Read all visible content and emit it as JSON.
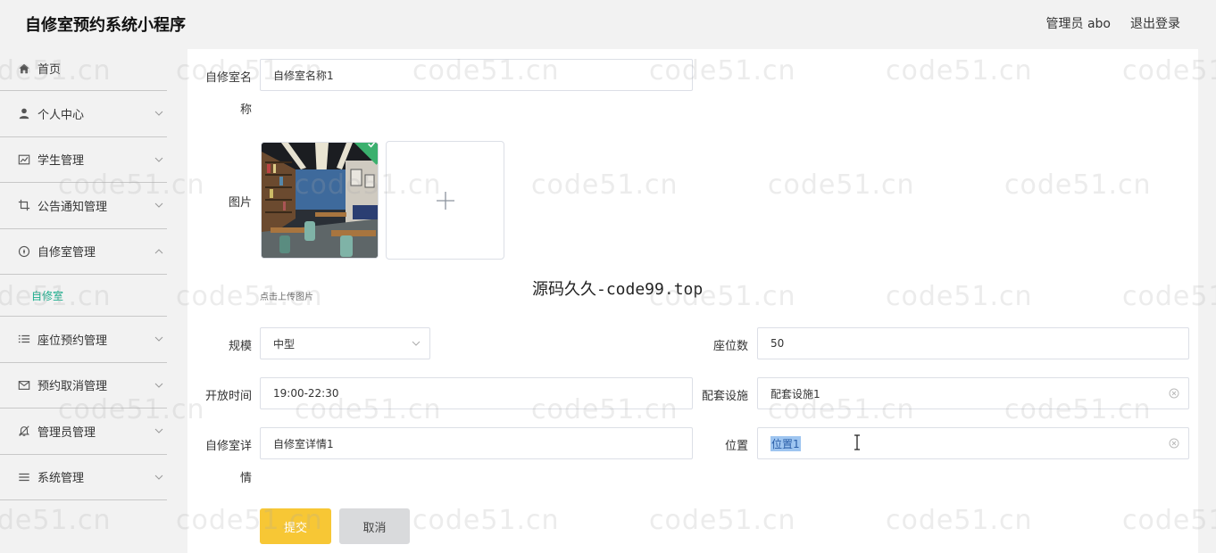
{
  "header": {
    "app_title": "自修室预约系统小程序",
    "user_label": "管理员 abo",
    "logout_label": "退出登录"
  },
  "sidebar": {
    "items": [
      {
        "label": "首页",
        "icon": "home-icon"
      },
      {
        "label": "个人中心",
        "icon": "person-icon"
      },
      {
        "label": "学生管理",
        "icon": "chart-icon"
      },
      {
        "label": "公告通知管理",
        "icon": "crop-icon"
      },
      {
        "label": "自修室管理",
        "icon": "compass-icon",
        "expanded": true,
        "children": [
          {
            "label": "自修室",
            "active": true
          }
        ]
      },
      {
        "label": "座位预约管理",
        "icon": "list-icon"
      },
      {
        "label": "预约取消管理",
        "icon": "mail-icon"
      },
      {
        "label": "管理员管理",
        "icon": "bell-icon"
      },
      {
        "label": "系统管理",
        "icon": "menu-icon"
      }
    ]
  },
  "form": {
    "name_label_1": "自修室名",
    "name_label_2": "称",
    "name_value": "自修室名称1",
    "image_label": "图片",
    "upload_hint": "点击上传图片",
    "scale_label": "规模",
    "scale_value": "中型",
    "seats_label": "座位数",
    "seats_value": "50",
    "open_label": "开放时间",
    "open_value": "19:00-22:30",
    "facility_label": "配套设施",
    "facility_value": "配套设施1",
    "detail_label_1": "自修室详",
    "detail_label_2": "情",
    "detail_value": "自修室详情1",
    "location_label": "位置",
    "location_value": "位置1",
    "submit_label": "提交",
    "cancel_label": "取消"
  },
  "overlay": {
    "text": "源码久久-code99.top",
    "watermark": "code51.cn"
  },
  "colors": {
    "accent": "#1aad8c",
    "submit": "#f7c735",
    "cancel": "#d9dadc",
    "success": "#3bb06e"
  }
}
